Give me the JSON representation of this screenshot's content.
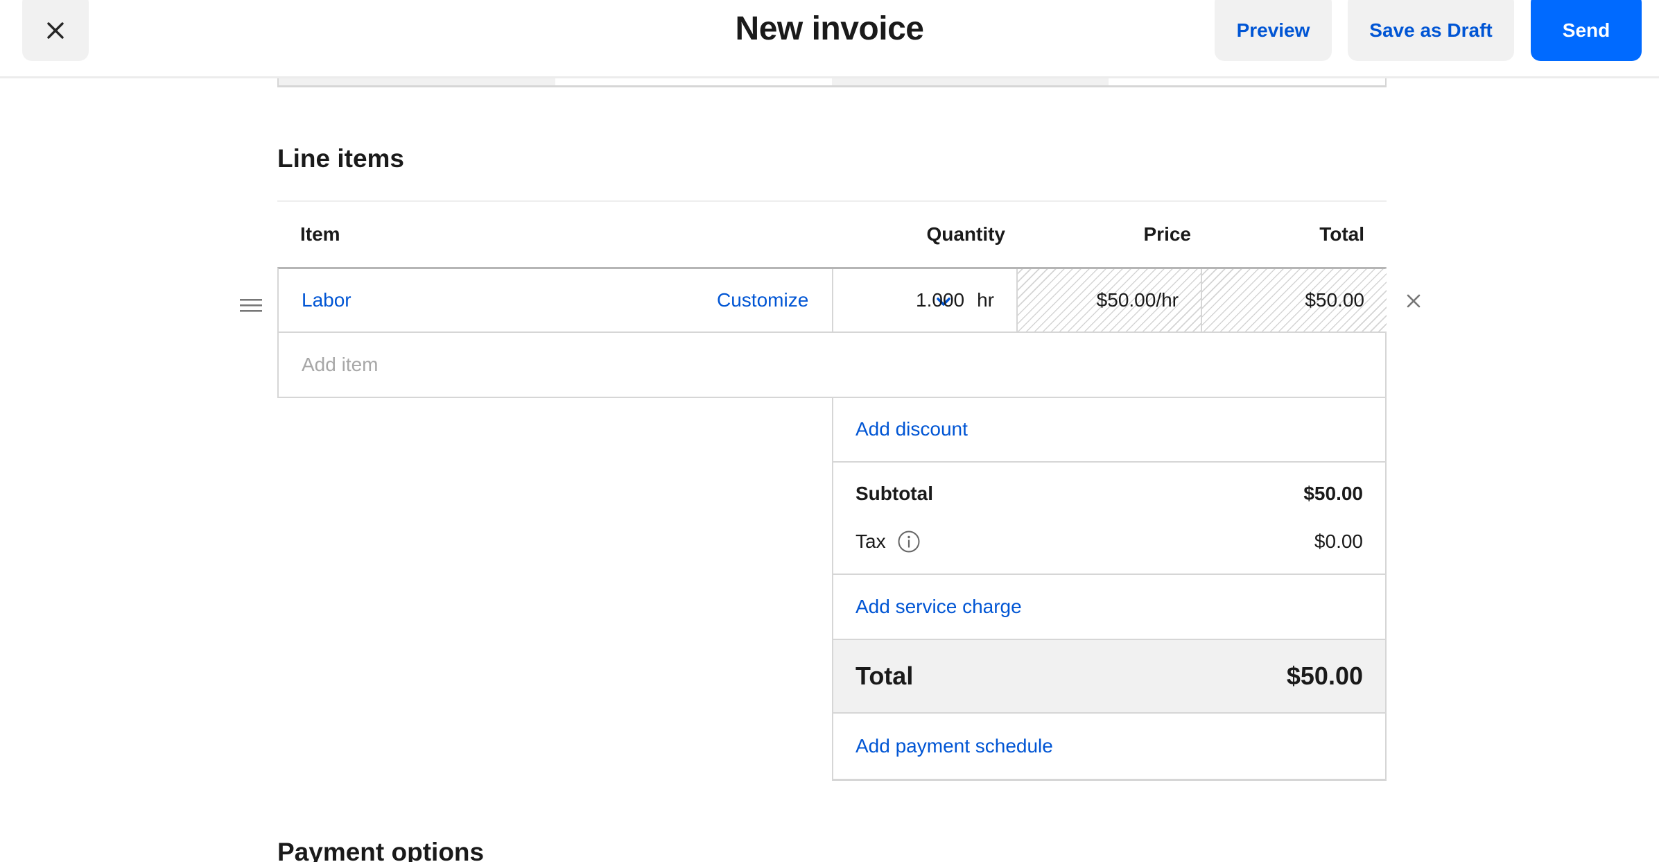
{
  "header": {
    "title": "New invoice",
    "close_icon": "close-icon",
    "buttons": {
      "preview": "Preview",
      "save_draft": "Save as Draft",
      "send": "Send"
    }
  },
  "colors": {
    "primary_blue": "#006aff",
    "link_blue": "#0055d4",
    "button_grey": "#f1f1f1",
    "text": "#1a1a1a",
    "placeholder": "#a7a7a7"
  },
  "line_items": {
    "title": "Line items",
    "columns": {
      "item": "Item",
      "quantity": "Quantity",
      "price": "Price",
      "total": "Total"
    },
    "rows": [
      {
        "item": "Labor",
        "customize_label": "Customize",
        "quantity": "1.000",
        "unit": "hr",
        "price": "$50.00/hr",
        "total": "$50.00",
        "drag_icon": "drag-handle-icon",
        "dropdown_icon": "chevron-down-icon",
        "remove_icon": "close-icon"
      }
    ],
    "add_item_placeholder": "Add item"
  },
  "summary": {
    "add_discount": "Add discount",
    "subtotal_label": "Subtotal",
    "subtotal_value": "$50.00",
    "tax_label": "Tax",
    "tax_info_icon": "info-icon",
    "tax_value": "$0.00",
    "add_service_charge": "Add service charge",
    "total_label": "Total",
    "total_value": "$50.00",
    "add_payment_schedule": "Add payment schedule"
  },
  "payment_options": {
    "title": "Payment options"
  }
}
